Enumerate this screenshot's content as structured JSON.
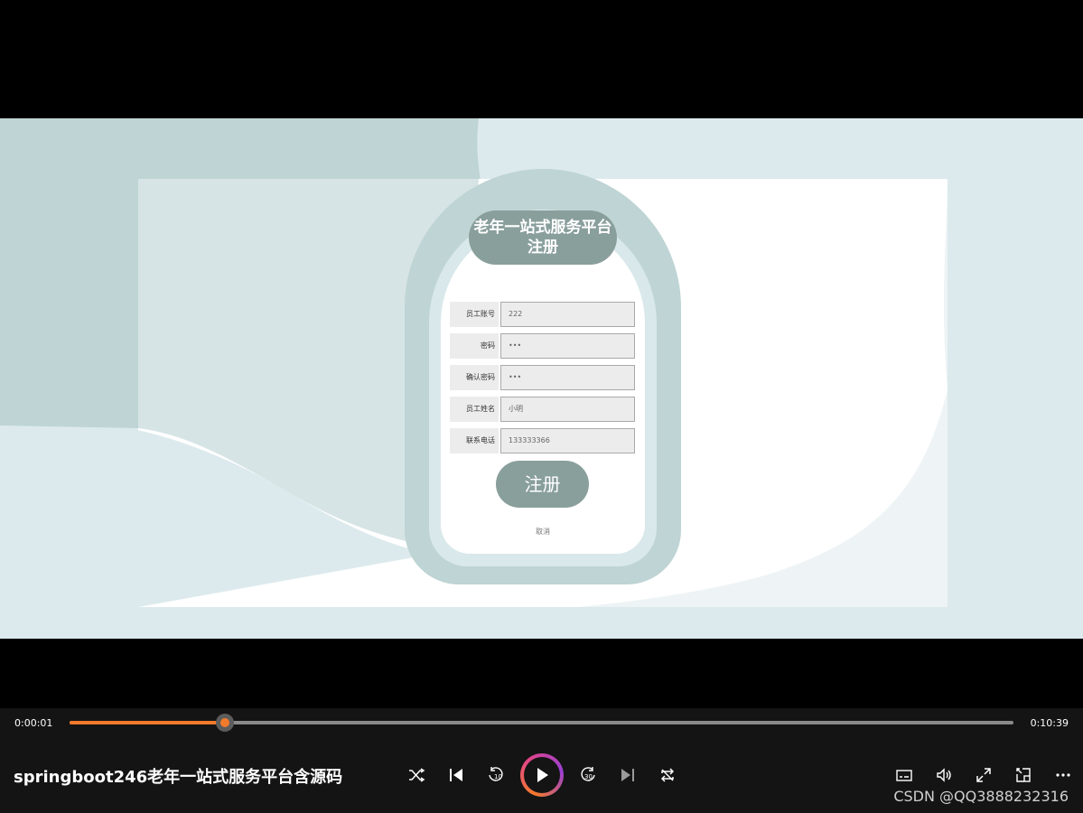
{
  "form": {
    "title_line1": "老年一站式服务平台",
    "title_line2": "注册",
    "fields": [
      {
        "label": "员工账号",
        "value": "222"
      },
      {
        "label": "密码",
        "value": "•••"
      },
      {
        "label": "确认密码",
        "value": "•••"
      },
      {
        "label": "员工姓名",
        "value": "小明"
      },
      {
        "label": "联系电话",
        "value": "133333366"
      }
    ],
    "submit_label": "注册",
    "cancel_label": "取消"
  },
  "player": {
    "current_time": "0:00:01",
    "duration": "0:10:39",
    "progress_fraction": 0.165,
    "video_title": "springboot246老年一站式服务平台含源码",
    "accent_color": "#f47a2b",
    "controls": [
      "shuffle-icon",
      "previous-icon",
      "rewind-10-icon",
      "play-icon",
      "forward-30-icon",
      "next-icon",
      "repeat-icon",
      "subtitles-icon",
      "volume-icon",
      "fullscreen-icon",
      "mini-player-icon",
      "more-icon"
    ]
  },
  "watermark": "CSDN @QQ3888232316"
}
